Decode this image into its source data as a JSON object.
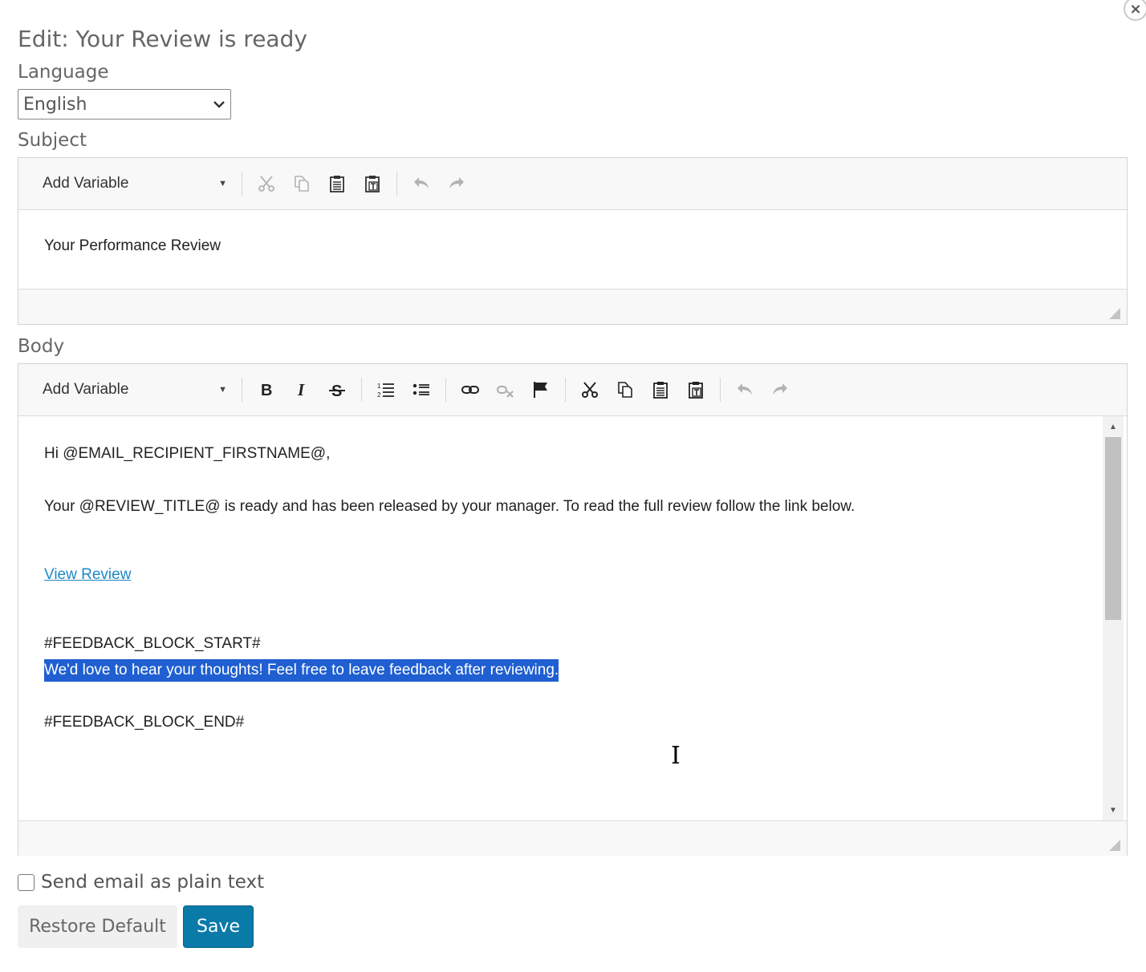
{
  "dialog": {
    "title": "Edit: Your Review is ready",
    "close_glyph": "×"
  },
  "language": {
    "label": "Language",
    "selected": "English",
    "chevron": "⌄"
  },
  "subject": {
    "label": "Subject",
    "toolbar": {
      "add_variable": "Add Variable"
    },
    "text": "Your Performance Review"
  },
  "body": {
    "label": "Body",
    "toolbar": {
      "add_variable": "Add Variable"
    },
    "lines": {
      "greeting": "Hi @EMAIL_RECIPIENT_FIRSTNAME@,",
      "intro": "Your @REVIEW_TITLE@ is ready and has been released by your manager. To read the full review follow the link below.",
      "link": "View Review",
      "feedback_start": "#FEEDBACK_BLOCK_START#",
      "feedback_text": "We'd love to hear your thoughts! Feel free to leave feedback after reviewing.",
      "feedback_end": "#FEEDBACK_BLOCK_END#"
    }
  },
  "options": {
    "plain_text_label": "Send email as plain text",
    "plain_text_checked": false
  },
  "buttons": {
    "restore": "Restore Default",
    "save": "Save"
  },
  "colors": {
    "save_button": "#0a7aa8",
    "link": "#1e88c6",
    "selection": "#1f5fd1"
  }
}
